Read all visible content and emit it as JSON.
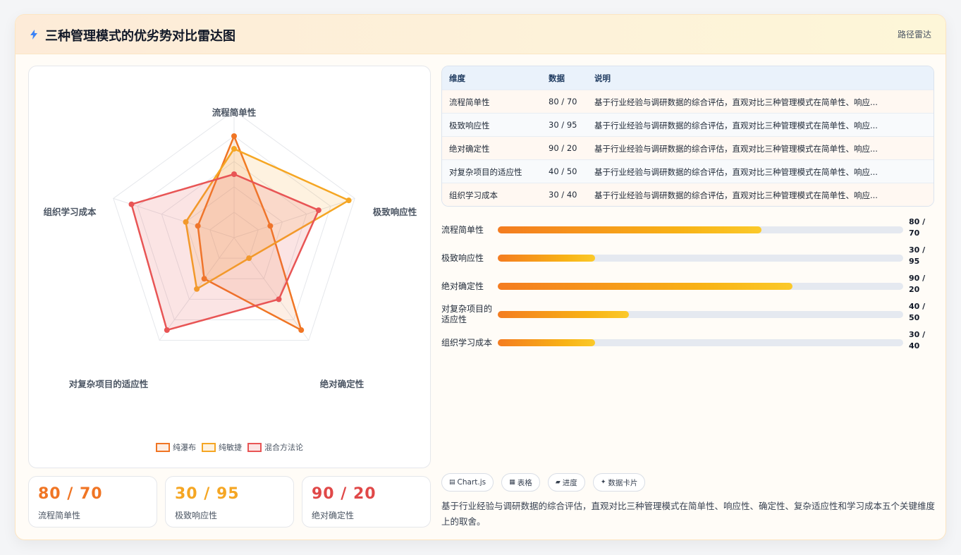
{
  "header": {
    "title": "三种管理模式的优劣势对比雷达图",
    "tag": "路径雷达",
    "icon": "bolt-icon"
  },
  "colors": {
    "waterfall": "#f07524",
    "agile": "#f5a623",
    "hybrid": "#e85555"
  },
  "chart_data": {
    "type": "radar",
    "axes": [
      "流程简单性",
      "极致响应性",
      "绝对确定性",
      "对复杂项目的适应性",
      "组织学习成本"
    ],
    "rmax": 100,
    "series": [
      {
        "name": "纯瀑布",
        "values": [
          80,
          30,
          90,
          40,
          30
        ]
      },
      {
        "name": "纯敏捷",
        "values": [
          70,
          95,
          20,
          50,
          40
        ]
      },
      {
        "name": "混合方法论",
        "values": [
          50,
          70,
          60,
          90,
          85
        ]
      }
    ],
    "legend_position": "bottom",
    "grid": true
  },
  "stats": [
    {
      "value": "80 / 70",
      "label": "流程简单性"
    },
    {
      "value": "30 / 95",
      "label": "极致响应性"
    },
    {
      "value": "90 / 20",
      "label": "绝对确定性"
    }
  ],
  "table": {
    "headers": [
      "维度",
      "数据",
      "说明"
    ],
    "rows": [
      [
        "流程简单性",
        "80 / 70",
        "基于行业经验与调研数据的综合评估，直观对比三种管理模式在简单性、响应..."
      ],
      [
        "极致响应性",
        "30 / 95",
        "基于行业经验与调研数据的综合评估，直观对比三种管理模式在简单性、响应..."
      ],
      [
        "绝对确定性",
        "90 / 20",
        "基于行业经验与调研数据的综合评估，直观对比三种管理模式在简单性、响应..."
      ],
      [
        "对复杂项目的适应性",
        "40 / 50",
        "基于行业经验与调研数据的综合评估，直观对比三种管理模式在简单性、响应..."
      ],
      [
        "组织学习成本",
        "30 / 40",
        "基于行业经验与调研数据的综合评估，直观对比三种管理模式在简单性、响应..."
      ]
    ]
  },
  "bars": [
    {
      "label": "流程简单性",
      "value": "80 / 70",
      "fraction": 0.65
    },
    {
      "label": "极致响应性",
      "value": "30 / 95",
      "fraction": 0.24
    },
    {
      "label": "绝对确定性",
      "value": "90 / 20",
      "fraction": 0.727
    },
    {
      "label": "对复杂项目的适应性",
      "value": "40 / 50",
      "fraction": 0.323
    },
    {
      "label": "组织学习成本",
      "value": "30 / 40",
      "fraction": 0.24
    }
  ],
  "chips": [
    {
      "icon": "chart-icon",
      "glyph": "▤",
      "label": "Chart.js"
    },
    {
      "icon": "table-icon",
      "glyph": "▦",
      "label": "表格"
    },
    {
      "icon": "progress-icon",
      "glyph": "▰",
      "label": "进度"
    },
    {
      "icon": "sparkle-icon",
      "glyph": "✦",
      "label": "数据卡片"
    }
  ],
  "description": "基于行业经验与调研数据的综合评估，直观对比三种管理模式在简单性、响应性、确定性、复杂适应性和学习成本五个关键维度上的取舍。"
}
